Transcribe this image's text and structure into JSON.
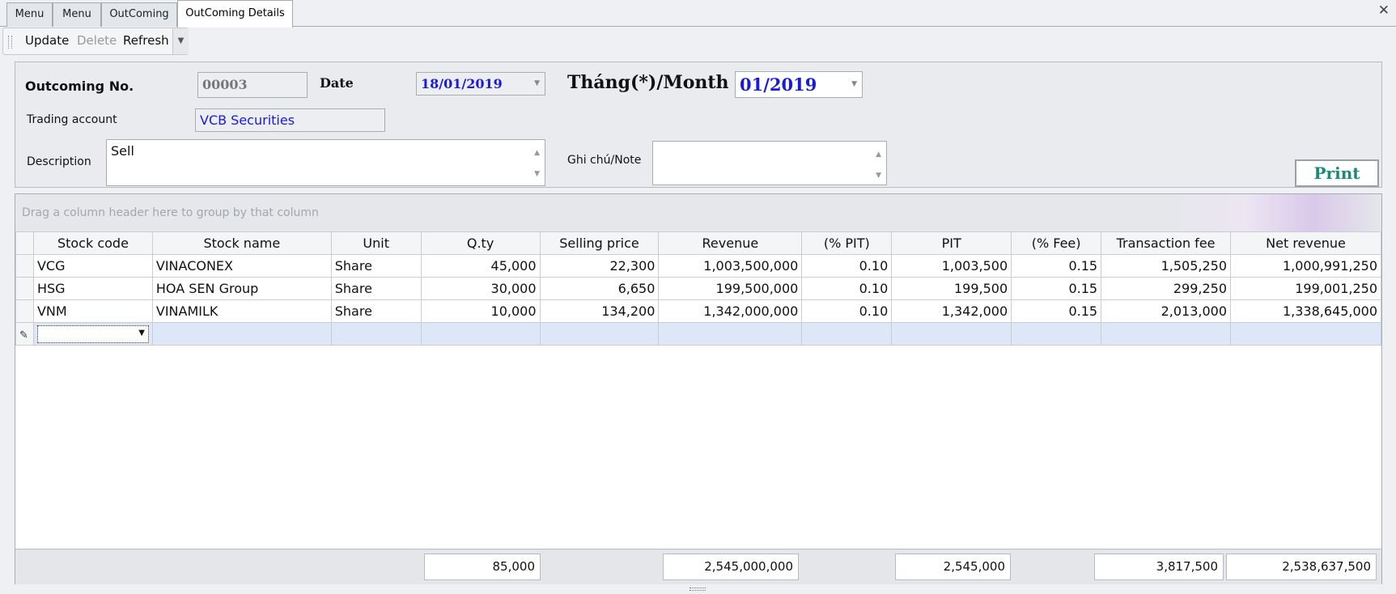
{
  "tabs": [
    {
      "label": "Menu"
    },
    {
      "label": "Menu"
    },
    {
      "label": "OutComing"
    },
    {
      "label": "OutComing Details"
    }
  ],
  "toolbar": {
    "update": "Update",
    "delete": "Delete",
    "refresh": "Refresh"
  },
  "form": {
    "outcoming_no_label": "Outcoming No.",
    "outcoming_no_value": "00003",
    "date_label": "Date",
    "date_value": "18/01/2019",
    "month_label": "Tháng(*)/Month",
    "month_value": "01/2019",
    "trading_account_label": "Trading account",
    "trading_account_value": "VCB Securities",
    "description_label": "Description",
    "description_value": "Sell",
    "note_label": "Ghi chú/Note",
    "note_value": "",
    "print_label": "Print"
  },
  "grid": {
    "group_hint": "Drag a column header here to group by that column",
    "columns": [
      "Stock code",
      "Stock name",
      "Unit",
      "Q.ty",
      "Selling price",
      "Revenue",
      "(% PIT)",
      "PIT",
      "(% Fee)",
      "Transaction fee",
      "Net revenue"
    ],
    "rows": [
      [
        "VCG",
        "VINACONEX",
        "Share",
        "45,000",
        "22,300",
        "1,003,500,000",
        "0.10",
        "1,003,500",
        "0.15",
        "1,505,250",
        "1,000,991,250"
      ],
      [
        "HSG",
        "HOA SEN Group",
        "Share",
        "30,000",
        "6,650",
        "199,500,000",
        "0.10",
        "199,500",
        "0.15",
        "299,250",
        "199,001,250"
      ],
      [
        "VNM",
        "VINAMILK",
        "Share",
        "10,000",
        "134,200",
        "1,342,000,000",
        "0.10",
        "1,342,000",
        "0.15",
        "2,013,000",
        "1,338,645,000"
      ]
    ],
    "totals": {
      "qty": "85,000",
      "revenue": "2,545,000,000",
      "pit": "2,545,000",
      "transaction_fee": "3,817,500",
      "net_revenue": "2,538,637,500"
    }
  }
}
